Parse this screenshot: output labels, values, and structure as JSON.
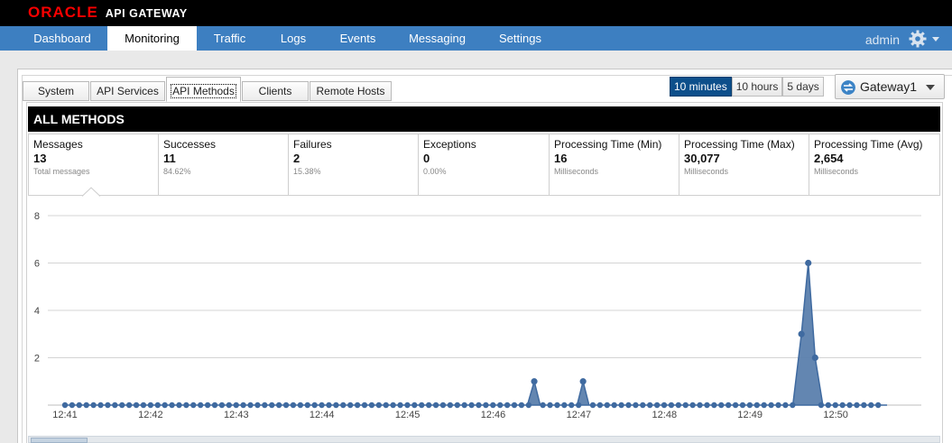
{
  "brand": {
    "oracle": "ORACLE",
    "product": "API GATEWAY",
    "registered": "®"
  },
  "nav": {
    "items": [
      "Dashboard",
      "Monitoring",
      "Traffic",
      "Logs",
      "Events",
      "Messaging",
      "Settings"
    ],
    "active": "Monitoring",
    "user": "admin",
    "gear_icon": "gear-icon"
  },
  "subtabs": {
    "items": [
      "System",
      "API Services",
      "API Methods",
      "Clients",
      "Remote Hosts"
    ],
    "active": "API Methods"
  },
  "time_range": {
    "options": [
      "10 minutes",
      "10 hours",
      "5 days"
    ],
    "selected": "10 minutes"
  },
  "gateway_select": {
    "value": "Gateway1",
    "icon": "gateway-icon"
  },
  "section_title": "ALL METHODS",
  "stats": [
    {
      "title": "Messages",
      "value": "13",
      "sub": "Total messages"
    },
    {
      "title": "Successes",
      "value": "11",
      "sub": "84.62%"
    },
    {
      "title": "Failures",
      "value": "2",
      "sub": "15.38%"
    },
    {
      "title": "Exceptions",
      "value": "0",
      "sub": "0.00%"
    },
    {
      "title": "Processing Time (Min)",
      "value": "16",
      "sub": "Milliseconds"
    },
    {
      "title": "Processing Time (Max)",
      "value": "30,077",
      "sub": "Milliseconds"
    },
    {
      "title": "Processing Time (Avg)",
      "value": "2,654",
      "sub": "Milliseconds"
    }
  ],
  "colors": {
    "accent": "#3d7fc1",
    "area_fill": "#5b80ad",
    "point": "#3f6aa0"
  },
  "chart_data": {
    "type": "area",
    "title": "",
    "xlabel": "",
    "ylabel": "",
    "ylim": [
      0,
      8
    ],
    "yticks": [
      2,
      4,
      6,
      8
    ],
    "grid": true,
    "xticks": [
      "12:41",
      "12:42",
      "12:43",
      "12:44",
      "12:45",
      "12:46",
      "12:47",
      "12:48",
      "12:49",
      "12:50"
    ],
    "xlim": [
      0,
      10
    ],
    "series": [
      {
        "points": [
          [
            5.4,
            0
          ],
          [
            5.48,
            1
          ],
          [
            5.55,
            0
          ],
          [
            5.98,
            0
          ],
          [
            6.05,
            1
          ],
          [
            6.12,
            0
          ],
          [
            8.5,
            0
          ],
          [
            8.6,
            3
          ],
          [
            8.68,
            6
          ],
          [
            8.76,
            2
          ],
          [
            8.85,
            0
          ]
        ]
      }
    ]
  }
}
